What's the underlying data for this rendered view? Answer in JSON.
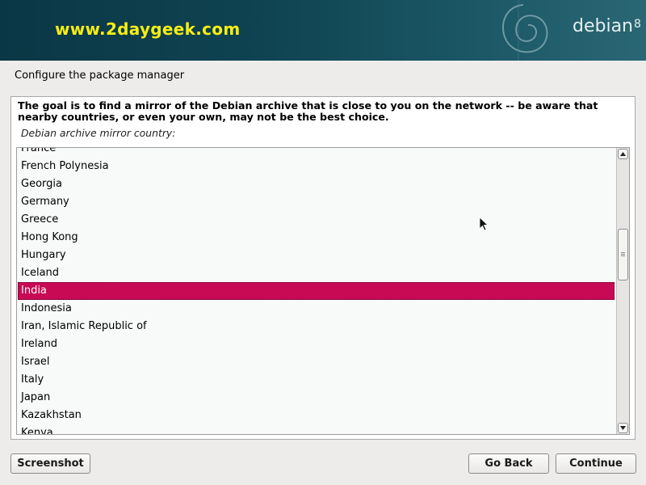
{
  "banner": {
    "watermark": "www.2daygeek.com",
    "logo_text": "debian",
    "logo_version": "8"
  },
  "page": {
    "title": "Configure the package manager"
  },
  "content": {
    "description": "The goal is to find a mirror of the Debian archive that is close to you on the network -- be aware that nearby countries, or even your own, may not be the best choice.",
    "field_label": "Debian archive mirror country:",
    "list_items": [
      "France",
      "French Polynesia",
      "Georgia",
      "Germany",
      "Greece",
      "Hong Kong",
      "Hungary",
      "Iceland",
      "India",
      "Indonesia",
      "Iran, Islamic Republic of",
      "Ireland",
      "Israel",
      "Italy",
      "Japan",
      "Kazakhstan",
      "Kenya"
    ],
    "selected_item": "India",
    "scrollbar_position": 0.33
  },
  "buttons": {
    "screenshot_label": "Screenshot",
    "back_label": "Go Back",
    "continue_label": "Continue"
  },
  "colors": {
    "banner_bg": "#0f4351",
    "watermark": "#f6ee14",
    "selection": "#c70a53",
    "page_bg": "#edeceb"
  },
  "icons": {
    "scroll_up": "triangle-up-icon",
    "scroll_down": "triangle-down-icon",
    "cursor": "mouse-pointer-icon",
    "logo": "debian-swirl-icon"
  }
}
